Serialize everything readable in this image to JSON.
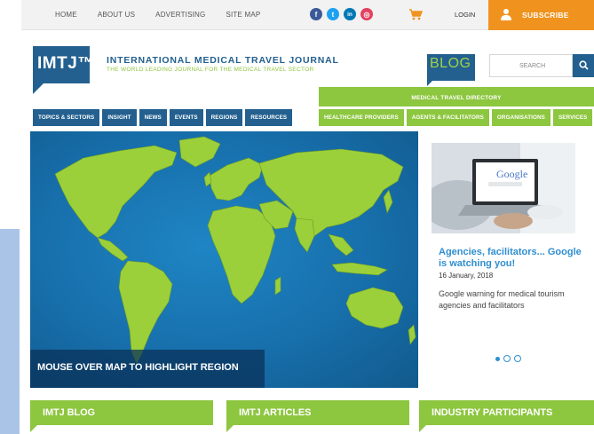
{
  "topnav": [
    "HOME",
    "ABOUT US",
    "ADVERTISING",
    "SITE MAP"
  ],
  "social": [
    {
      "name": "facebook-icon",
      "glyph": "f",
      "color": "#3b5998"
    },
    {
      "name": "twitter-icon",
      "glyph": "t",
      "color": "#1da1f2"
    },
    {
      "name": "linkedin-icon",
      "glyph": "in",
      "color": "#0077b5"
    },
    {
      "name": "instagram-icon",
      "glyph": "◎",
      "color": "#e4405f"
    }
  ],
  "account": {
    "login": "LOGIN",
    "subscribe": "SUBSCRIBE"
  },
  "brand": {
    "logo": "IMTJ™",
    "title": "INTERNATIONAL MEDICAL TRAVEL JOURNAL",
    "subtitle": "THE WORLD LEADING JOURNAL FOR THE MEDICAL TRAVEL SECTOR"
  },
  "blog_badge": "BLOG",
  "search": {
    "placeholder": "SEARCH"
  },
  "directory_header": "MEDICAL TRAVEL DIRECTORY",
  "nav_main": [
    "TOPICS & SECTORS",
    "INSIGHT",
    "NEWS",
    "EVENTS",
    "REGIONS",
    "RESOURCES"
  ],
  "nav_directory": [
    "HEALTHCARE PROVIDERS",
    "AGENTS & FACILITATORS",
    "ORGANISATIONS",
    "SERVICES"
  ],
  "map": {
    "caption": "MOUSE OVER MAP TO HIGHLIGHT REGION"
  },
  "feature": {
    "image_text": "Google",
    "title": "Agencies, facilitators... Google is watching you!",
    "date": "16 January, 2018",
    "description": "Google warning for medical tourism agencies and facilitators",
    "slide_count": 3,
    "active_slide": 1
  },
  "sections": [
    "IMTJ BLOG",
    "IMTJ ARTICLES",
    "INDUSTRY PARTICIPANTS"
  ],
  "colors": {
    "primary_blue": "#23608f",
    "accent_green": "#8dc63f",
    "subscribe_orange": "#f0931e",
    "link_blue": "#2f8ed0"
  }
}
